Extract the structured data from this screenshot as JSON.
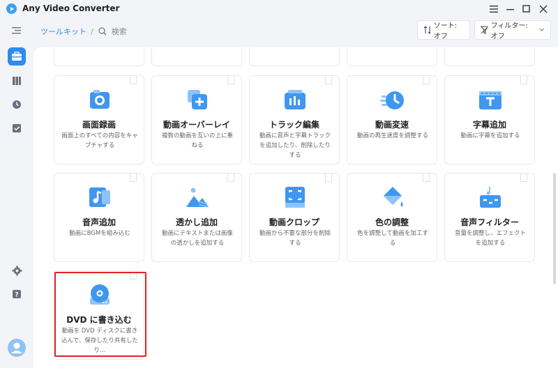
{
  "app": {
    "title": "Any Video Converter"
  },
  "window_controls": [
    "menu-icon",
    "minimize-icon",
    "maximize-icon",
    "close-icon"
  ],
  "header": {
    "breadcrumb_root": "ツールキット",
    "breadcrumb_sep": "/",
    "search_placeholder": "検索",
    "sort_label": "ソート:オフ",
    "filter_label": "フィルター:オフ"
  },
  "sidebar": {
    "items": [
      {
        "name": "collapse-icon"
      },
      {
        "name": "toolbox-icon",
        "active": true
      },
      {
        "name": "library-icon"
      },
      {
        "name": "history-icon"
      },
      {
        "name": "tasks-icon"
      },
      {
        "name": "settings-icon"
      },
      {
        "name": "help-icon"
      },
      {
        "name": "avatar"
      }
    ]
  },
  "tools": [
    {
      "title": "画面録画",
      "desc": "画面上のすべての内容をキャプチャする"
    },
    {
      "title": "動画オーバーレイ",
      "desc": "複数の動画を互いの上に重ねる"
    },
    {
      "title": "トラック編集",
      "desc": "動画に音声と字幕トラックを追加したり、削除したりする"
    },
    {
      "title": "動画変速",
      "desc": "動画の再生速度を調整する"
    },
    {
      "title": "字幕追加",
      "desc": "動画に字幕を追加する"
    },
    {
      "title": "音声追加",
      "desc": "動画にBGMを組み込む"
    },
    {
      "title": "透かし追加",
      "desc": "動画にテキストまたは画像の透かしを追加する"
    },
    {
      "title": "動画クロップ",
      "desc": "動画から不要な部分を削除する"
    },
    {
      "title": "色の調整",
      "desc": "色を調整して動画を加工する"
    },
    {
      "title": "音声フィルター",
      "desc": "音量を調整し、エフェクトを追加する"
    },
    {
      "title": "DVD に書き込む",
      "desc": "動画を DVD ディスクに書き込んで、保存したり共有したり…"
    }
  ],
  "colors": {
    "accent": "#2f8bf0",
    "highlight": "#e02424"
  }
}
